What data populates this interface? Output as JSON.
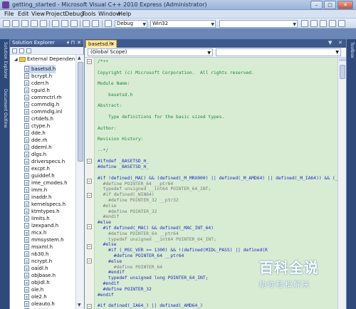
{
  "window": {
    "title": "getting_started - Microsoft Visual C++ 2010 Express (Administrator)",
    "controls": [
      "–",
      "□",
      "✕"
    ]
  },
  "menubar": {
    "items": [
      "File",
      "Edit",
      "View",
      "Project",
      "Debug",
      "Tools",
      "Window",
      "Help"
    ]
  },
  "toolbar": {
    "configuration": "Debug",
    "platform": "Win32",
    "find_value": ""
  },
  "left_strip": {
    "tabs": [
      "Solution Explorer",
      "Document Outline"
    ]
  },
  "right_strip": {
    "tabs": [
      "Toolbox"
    ]
  },
  "solution_explorer": {
    "title": "Solution Explorer",
    "pin": "▾ ⊓",
    "close": "✕",
    "root": "External Dependen",
    "items": [
      "basetsd.h",
      "bcrypt.h",
      "cderr.h",
      "cguid.h",
      "commctrl.rh",
      "commdlg.h",
      "commdlg.inl",
      "crtdefs.h",
      "ctype.h",
      "dde.h",
      "dde.rh",
      "ddeml.h",
      "dlgs.h",
      "driverspecs.h",
      "excpt.h",
      "guiddef.h",
      "ime_cmodes.h",
      "imm.h",
      "inaddr.h",
      "kernelspecs.h",
      "ktmtypes.h",
      "limits.h",
      "lzexpand.h",
      "mcx.h",
      "mmsystem.h",
      "msxml.h",
      "nb30.h",
      "ncrypt.h",
      "oaidl.h",
      "objbase.h",
      "objidl.h",
      "ole.h",
      "ole2.h",
      "oleauto.h",
      "oleidl.h"
    ]
  },
  "editor": {
    "tab_label": "basetsd.h",
    "tab_close": "✕",
    "scope": "(Global Scope)",
    "code_lines": [
      {
        "text": "/*++",
        "kind": "comment"
      },
      {
        "text": "",
        "kind": "comment"
      },
      {
        "text": "Copyright (c) Microsoft Corporation.  All rights reserved.",
        "kind": "comment"
      },
      {
        "text": "",
        "kind": "comment"
      },
      {
        "text": "Module Name:",
        "kind": "comment"
      },
      {
        "text": "",
        "kind": "comment"
      },
      {
        "text": "    basetsd.h",
        "kind": "comment"
      },
      {
        "text": "",
        "kind": "comment"
      },
      {
        "text": "Abstract:",
        "kind": "comment"
      },
      {
        "text": "",
        "kind": "comment"
      },
      {
        "text": "    Type definitions for the basic sized types.",
        "kind": "comment"
      },
      {
        "text": "",
        "kind": "comment"
      },
      {
        "text": "Author:",
        "kind": "comment"
      },
      {
        "text": "",
        "kind": "comment"
      },
      {
        "text": "Revision History:",
        "kind": "comment"
      },
      {
        "text": "",
        "kind": "comment"
      },
      {
        "text": "--*/",
        "kind": "comment"
      },
      {
        "text": "",
        "kind": "comment"
      },
      {
        "text": "#ifndef _BASETSD_H_",
        "kind": "pp"
      },
      {
        "text": "#define _BASETSD_H_",
        "kind": "pp"
      },
      {
        "text": "",
        "kind": "pp"
      },
      {
        "text": "#if !defined(_MAC) && (defined(_M_MRX000) || defined(_M_AMD64) || defined(_M_IA64)) && (_MSC_VER",
        "kind": "pp"
      },
      {
        "text": "  #define POINTER_64 __ptr64",
        "kind": "inactive"
      },
      {
        "text": "  typedef unsigned __int64 POINTER_64_INT;",
        "kind": "inactive"
      },
      {
        "text": "  #if defined(_WIN64)",
        "kind": "inactive"
      },
      {
        "text": "    #define POINTER_32 __ptr32",
        "kind": "inactive"
      },
      {
        "text": "  #else",
        "kind": "inactive"
      },
      {
        "text": "    #define POINTER_32",
        "kind": "inactive"
      },
      {
        "text": "  #endif",
        "kind": "inactive"
      },
      {
        "text": "#else",
        "kind": "pp"
      },
      {
        "text": "  #if defined(_MAC) && defined(_MAC_INT_64)",
        "kind": "pp"
      },
      {
        "text": "    #define POINTER_64 __ptr64",
        "kind": "inactive"
      },
      {
        "text": "    typedef unsigned __int64 POINTER_64_INT;",
        "kind": "inactive"
      },
      {
        "text": "  #else",
        "kind": "pp"
      },
      {
        "text": "    #if (_MSC_VER >= 1300) && !(defined(MIDL_PASS) || defined(R",
        "kind": "pp"
      },
      {
        "text": "      #define POINTER_64 __ptr64",
        "kind": "pp"
      },
      {
        "text": "    #else",
        "kind": "pp"
      },
      {
        "text": "      #define POINTER_64",
        "kind": "inactive"
      },
      {
        "text": "    #endif",
        "kind": "pp"
      },
      {
        "text": "    typedef unsigned long POINTER_64_INT;",
        "kind": "pp"
      },
      {
        "text": "  #endif",
        "kind": "pp"
      },
      {
        "text": "  #define POINTER_32",
        "kind": "pp"
      },
      {
        "text": "#endif",
        "kind": "pp"
      },
      {
        "text": "",
        "kind": "pp"
      },
      {
        "text": "#if defined(_IA64_) || defined(_AMD64_)",
        "kind": "pp"
      }
    ]
  },
  "watermark": {
    "main": "百科全说",
    "sub": "助你轻松解决"
  }
}
